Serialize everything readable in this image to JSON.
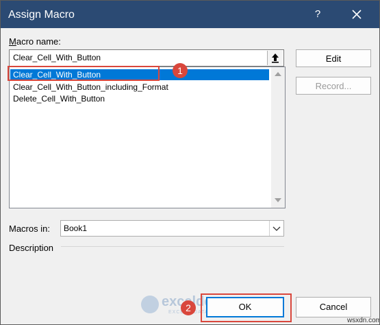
{
  "dialog": {
    "title": "Assign Macro",
    "help_label": "?"
  },
  "macro_name": {
    "label_accel": "M",
    "label_rest": "acro name:",
    "value": "Clear_Cell_With_Button"
  },
  "macro_list": {
    "items": [
      {
        "label": "Clear_Cell_With_Button",
        "selected": true
      },
      {
        "label": "Clear_Cell_With_Button_including_Format",
        "selected": false
      },
      {
        "label": "Delete_Cell_With_Button",
        "selected": false
      }
    ]
  },
  "buttons": {
    "edit": "Edit",
    "record": "Record...",
    "ok": "OK",
    "cancel": "Cancel"
  },
  "macros_in": {
    "label": "Macros in:",
    "value": "Book1"
  },
  "description": {
    "label": "Description"
  },
  "annotations": {
    "badge_1": "1",
    "badge_2": "2",
    "color": "#d9473c"
  },
  "watermark": {
    "name": "exceldemy",
    "tagline": "EXCEL · DATA · BI"
  },
  "site_tag": "wsxdn.com",
  "colors": {
    "titlebar": "#2b4a73",
    "selection": "#0078d7",
    "dialog_bg": "#f0f0f0"
  }
}
